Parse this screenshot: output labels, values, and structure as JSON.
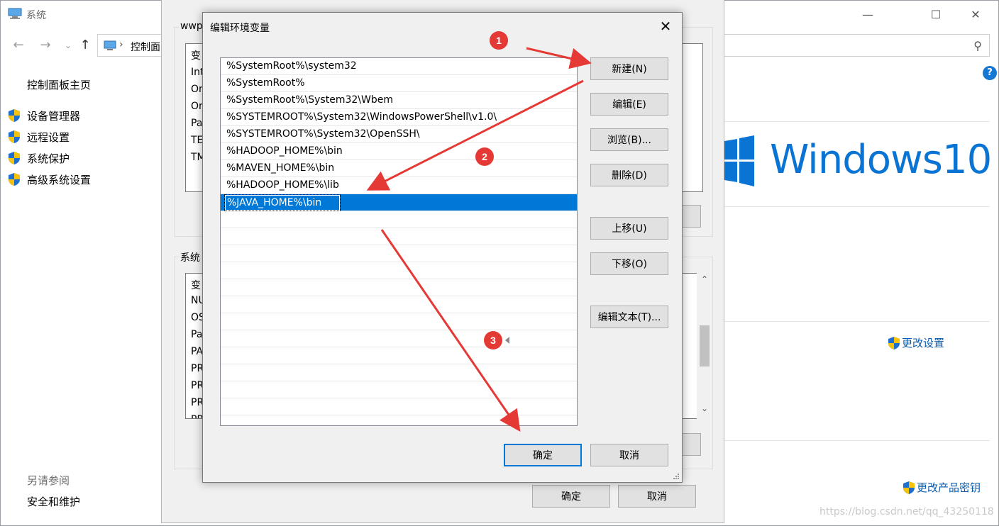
{
  "system_window": {
    "title": "系统",
    "address": {
      "crumb": "控制面"
    },
    "controls": {
      "minimize": "—",
      "maximize": "☐",
      "close": "✕"
    },
    "sidebar": {
      "home": "控制面板主页",
      "items": [
        {
          "label": "设备管理器"
        },
        {
          "label": "远程设置"
        },
        {
          "label": "系统保护"
        },
        {
          "label": "高级系统设置"
        }
      ],
      "see_also_heading": "另请参阅",
      "see_also_link": "安全和维护"
    },
    "logo_text": "Windows10",
    "change_settings": "更改设置",
    "change_product_key": "更改产品密钥",
    "help": "?",
    "watermark": "https://blog.csdn.net/qq_43250118"
  },
  "env_window": {
    "user_group_label": "wwp",
    "user_vars": [
      "变",
      "Int",
      "On",
      "On",
      "Pa",
      "TE",
      "TM"
    ],
    "system_group_label": "系统",
    "system_vars": [
      "变",
      "NU",
      "OS",
      "Pa",
      "PA",
      "PR",
      "PR",
      "PR",
      "PR"
    ],
    "ok": "确定",
    "cancel": "取消"
  },
  "edit_dialog": {
    "title": "编辑环境变量",
    "close": "✕",
    "paths": [
      "%SystemRoot%\\system32",
      "%SystemRoot%",
      "%SystemRoot%\\System32\\Wbem",
      "%SYSTEMROOT%\\System32\\WindowsPowerShell\\v1.0\\",
      "%SYSTEMROOT%\\System32\\OpenSSH\\",
      "%HADOOP_HOME%\\bin",
      "%MAVEN_HOME%\\bin",
      "%HADOOP_HOME%\\lib",
      "%JAVA_HOME%\\bin"
    ],
    "selected_index": 8,
    "buttons": {
      "new": "新建(N)",
      "edit": "编辑(E)",
      "browse": "浏览(B)...",
      "delete": "删除(D)",
      "move_up": "上移(U)",
      "move_down": "下移(O)",
      "edit_text": "编辑文本(T)...",
      "ok": "确定",
      "cancel": "取消"
    }
  },
  "annotations": {
    "badges": [
      "1",
      "2",
      "3"
    ],
    "color": "#e53935"
  },
  "colors": {
    "accent": "#0078d7",
    "logo": "#0a74d4",
    "link": "#0b5cad"
  }
}
